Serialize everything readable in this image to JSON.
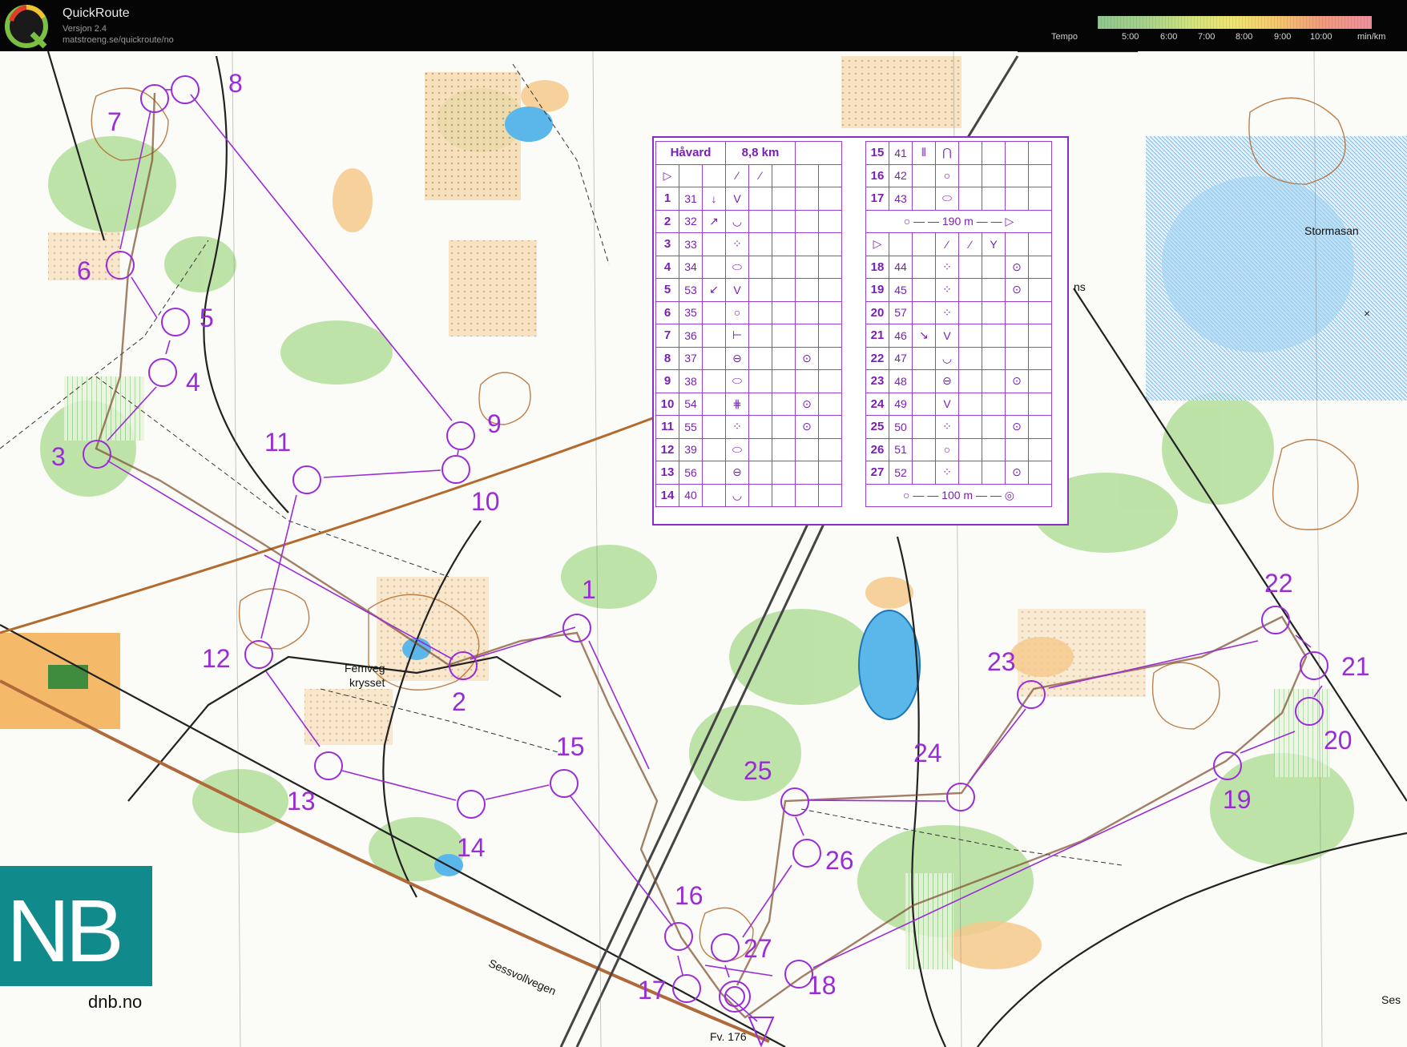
{
  "app": {
    "name": "QuickRoute",
    "version": "Versjon 2.4",
    "url": "matstroeng.se/quickroute/no"
  },
  "tempo": {
    "label": "Tempo",
    "ticks": [
      "5:00",
      "6:00",
      "7:00",
      "8:00",
      "9:00",
      "10:00"
    ],
    "unit": "min/km"
  },
  "map": {
    "place_names": [
      "Stormasan",
      "Femveg-",
      "krysset",
      "Sessvollvegen",
      "Fv. 176",
      "Ses",
      "ns"
    ],
    "controls": [
      "1",
      "2",
      "3",
      "4",
      "5",
      "6",
      "7",
      "8",
      "9",
      "10",
      "11",
      "12",
      "13",
      "14",
      "15",
      "16",
      "17",
      "18",
      "19",
      "20",
      "21",
      "22",
      "23",
      "24",
      "25",
      "26",
      "27"
    ]
  },
  "description_sheet": {
    "name": "Håvard",
    "distance": "8,8 km",
    "left_rows": [
      {
        "n": "1",
        "code": "31"
      },
      {
        "n": "2",
        "code": "32"
      },
      {
        "n": "3",
        "code": "33"
      },
      {
        "n": "4",
        "code": "34"
      },
      {
        "n": "5",
        "code": "53"
      },
      {
        "n": "6",
        "code": "35"
      },
      {
        "n": "7",
        "code": "36"
      },
      {
        "n": "8",
        "code": "37"
      },
      {
        "n": "9",
        "code": "38"
      },
      {
        "n": "10",
        "code": "54"
      },
      {
        "n": "11",
        "code": "55"
      },
      {
        "n": "12",
        "code": "39"
      },
      {
        "n": "13",
        "code": "56"
      },
      {
        "n": "14",
        "code": "40"
      }
    ],
    "right_top_rows": [
      {
        "n": "15",
        "code": "41"
      },
      {
        "n": "16",
        "code": "42"
      },
      {
        "n": "17",
        "code": "43"
      }
    ],
    "marked_route_1": "190 m",
    "right_rows": [
      {
        "n": "18",
        "code": "44"
      },
      {
        "n": "19",
        "code": "45"
      },
      {
        "n": "20",
        "code": "57"
      },
      {
        "n": "21",
        "code": "46"
      },
      {
        "n": "22",
        "code": "47"
      },
      {
        "n": "23",
        "code": "48"
      },
      {
        "n": "24",
        "code": "49"
      },
      {
        "n": "25",
        "code": "50"
      },
      {
        "n": "26",
        "code": "51"
      },
      {
        "n": "27",
        "code": "52"
      }
    ],
    "marked_route_2": "100 m"
  },
  "sponsor": {
    "logo_text": "NB",
    "url": "dnb.no"
  },
  "colors": {
    "course": "#9a2bd8",
    "topbar": "#050505",
    "sponsor": "#108a8a"
  }
}
